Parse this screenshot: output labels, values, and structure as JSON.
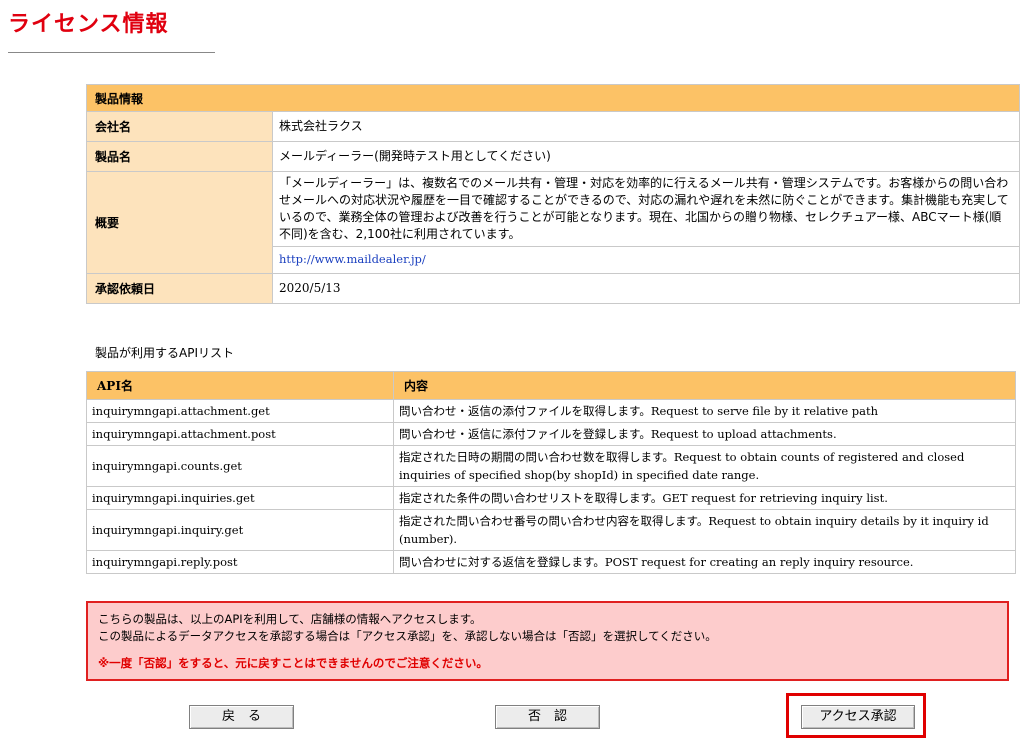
{
  "page": {
    "title": "ライセンス情報"
  },
  "product": {
    "section_header": "製品情報",
    "company_label": "会社名",
    "company_value": "株式会社ラクス",
    "product_label": "製品名",
    "product_value": "メールディーラー(開発時テスト用としてください)",
    "summary_label": "概要",
    "summary_text": "「メールディーラー」は、複数名でのメール共有・管理・対応を効率的に行えるメール共有・管理システムです。お客様からの問い合わせメールへの対応状況や履歴を一目で確認することができるので、対応の漏れや遅れを未然に防ぐことができます。集計機能も充実しているので、業務全体の管理および改善を行うことが可能となります。現在、北国からの贈り物様、セレクチュアー様、ABCマート様(順不同)を含む、2,100社に利用されています。",
    "summary_link": "http://www.maildealer.jp/",
    "approval_date_label": "承認依頼日",
    "approval_date_value": "2020/5/13"
  },
  "api": {
    "caption": "製品が利用するAPIリスト",
    "col_name": "API名",
    "col_content": "内容",
    "rows": [
      {
        "name": "inquirymngapi.attachment.get",
        "content": "問い合わせ・返信の添付ファイルを取得します。Request to serve file by it relative path"
      },
      {
        "name": "inquirymngapi.attachment.post",
        "content": "問い合わせ・返信に添付ファイルを登録します。Request to upload attachments."
      },
      {
        "name": "inquirymngapi.counts.get",
        "content": "指定された日時の期間の問い合わせ数を取得します。Request to obtain counts of registered and closed inquiries of specified shop(by shopId) in specified date range."
      },
      {
        "name": "inquirymngapi.inquiries.get",
        "content": "指定された条件の問い合わせリストを取得します。GET request for retrieving inquiry list."
      },
      {
        "name": "inquirymngapi.inquiry.get",
        "content": "指定された問い合わせ番号の問い合わせ内容を取得します。Request to obtain inquiry details by it inquiry id (number)."
      },
      {
        "name": "inquirymngapi.reply.post",
        "content": "問い合わせに対する返信を登録します。POST request for creating an reply inquiry resource."
      }
    ]
  },
  "notice": {
    "line1": "こちらの製品は、以上のAPIを利用して、店舗様の情報へアクセスします。",
    "line2": "この製品によるデータアクセスを承認する場合は「アクセス承認」を、承認しない場合は「否認」を選択してください。",
    "alert": "※一度「否認」をすると、元に戻すことはできませんのでご注意ください。"
  },
  "buttons": {
    "back": "戻　る",
    "deny": "否　認",
    "approve": "アクセス承認"
  },
  "colors": {
    "title_red": "#e0000f",
    "header_orange": "#fcc266",
    "label_peach": "#fde3bc",
    "notice_pink": "#fdcccc",
    "alert_red": "#e00000",
    "link_blue": "#1a3fbf"
  }
}
